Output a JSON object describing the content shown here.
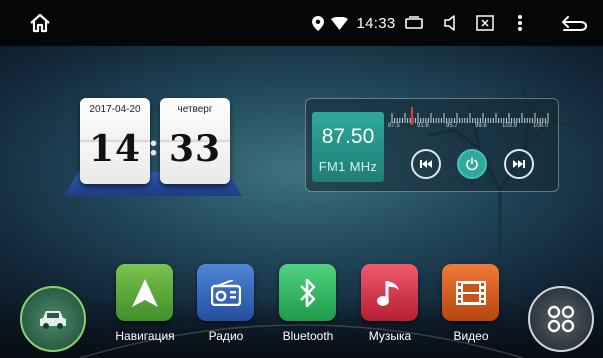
{
  "status_bar": {
    "time": "14:33",
    "icons": [
      "home-icon",
      "location-icon",
      "wifi-icon",
      "cast-icon",
      "volume-icon",
      "screenshot-icon",
      "more-icon",
      "back-icon"
    ]
  },
  "clock": {
    "date": "2017-04-20",
    "weekday": "четверг",
    "hours": "14",
    "minutes": "33",
    "separator": ":"
  },
  "radio": {
    "frequency": "87.50",
    "band": "FM1 MHz",
    "scale_labels": [
      "87.5",
      "91.6",
      "95.7",
      "99.8",
      "103.9",
      "108.0"
    ],
    "current_frequency_mhz": 87.5
  },
  "dock": {
    "apps": [
      {
        "label": "Навигация",
        "icon": "navigation-arrow-icon",
        "color": "#5aa83a"
      },
      {
        "label": "Радио",
        "icon": "radio-icon",
        "color": "#2f62b8"
      },
      {
        "label": "Bluetooth",
        "icon": "bluetooth-icon",
        "color": "#2bb35a"
      },
      {
        "label": "Музыка",
        "icon": "music-note-icon",
        "color": "#d8334a"
      },
      {
        "label": "Видео",
        "icon": "film-icon",
        "color": "#cf5a1c"
      }
    ],
    "left_button_icon": "car-icon",
    "right_button_icon": "app-grid-icon"
  },
  "colors": {
    "accent": "#2fa99a",
    "status_bar": "#050607"
  }
}
